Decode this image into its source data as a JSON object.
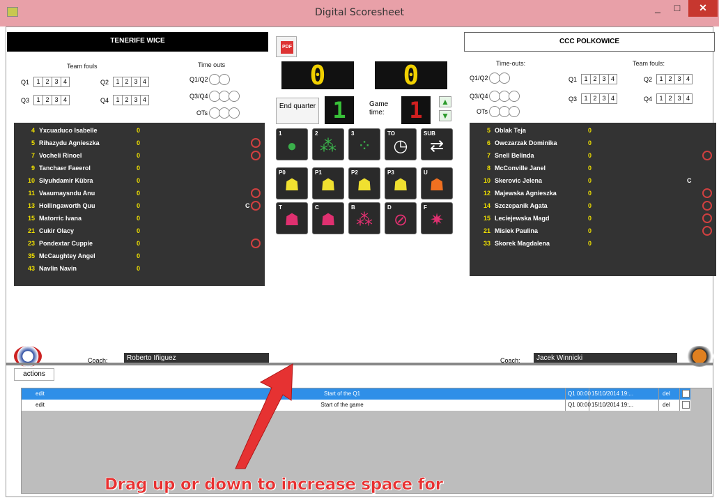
{
  "window": {
    "title": "Digital Scoresheet",
    "min": "_",
    "max": "□",
    "close": "✕"
  },
  "home": {
    "name": "TENERIFE WICE",
    "team_fouls_label": "Team fouls",
    "timeouts_label": "Time outs",
    "fouls": [
      {
        "q": "Q1",
        "cells": [
          "1",
          "2",
          "3",
          "4"
        ]
      },
      {
        "q": "Q2",
        "cells": [
          "1",
          "2",
          "3",
          "4"
        ]
      },
      {
        "q": "Q3",
        "cells": [
          "1",
          "2",
          "3",
          "4"
        ]
      },
      {
        "q": "Q4",
        "cells": [
          "1",
          "2",
          "3",
          "4"
        ]
      }
    ],
    "timeouts": [
      "Q1/Q2",
      "Q3/Q4",
      "OTs"
    ],
    "players": [
      {
        "num": "4",
        "name": "Yxcuaduco Isabelle",
        "pts": "0",
        "cap": "",
        "fouls": 0
      },
      {
        "num": "5",
        "name": "Rihazydu Agnieszka",
        "pts": "0",
        "cap": "",
        "fouls": 1
      },
      {
        "num": "7",
        "name": "Vocheli Rinoel",
        "pts": "0",
        "cap": "",
        "fouls": 1
      },
      {
        "num": "9",
        "name": "Tanchaer Faeerol",
        "pts": "0",
        "cap": "",
        "fouls": 0
      },
      {
        "num": "10",
        "name": "Siyuhdamir Kübra",
        "pts": "0",
        "cap": "",
        "fouls": 0
      },
      {
        "num": "11",
        "name": "Vaaumaysndu Anu",
        "pts": "0",
        "cap": "",
        "fouls": 1
      },
      {
        "num": "13",
        "name": "Hollingaworth Quu",
        "pts": "0",
        "cap": "C",
        "fouls": 1
      },
      {
        "num": "15",
        "name": "Matorric Ivana",
        "pts": "0",
        "cap": "",
        "fouls": 0
      },
      {
        "num": "21",
        "name": "Cukir Olacy",
        "pts": "0",
        "cap": "",
        "fouls": 0
      },
      {
        "num": "23",
        "name": "Pondextar Cuppie",
        "pts": "0",
        "cap": "",
        "fouls": 1
      },
      {
        "num": "35",
        "name": "McCaughtey Angel",
        "pts": "0",
        "cap": "",
        "fouls": 0
      },
      {
        "num": "43",
        "name": "Navlin Navin",
        "pts": "0",
        "cap": "",
        "fouls": 0
      }
    ],
    "coach_label": "Coach:",
    "coach": "Roberto Iñiguez"
  },
  "away": {
    "name": "CCC POLKOWICE",
    "team_fouls_label": "Team fouls:",
    "timeouts_label": "Time-outs:",
    "fouls": [
      {
        "q": "Q1",
        "cells": [
          "1",
          "2",
          "3",
          "4"
        ]
      },
      {
        "q": "Q2",
        "cells": [
          "1",
          "2",
          "3",
          "4"
        ]
      },
      {
        "q": "Q3",
        "cells": [
          "1",
          "2",
          "3",
          "4"
        ]
      },
      {
        "q": "Q4",
        "cells": [
          "1",
          "2",
          "3",
          "4"
        ]
      }
    ],
    "timeouts": [
      "Q1/Q2",
      "Q3/Q4",
      "OTs"
    ],
    "players": [
      {
        "num": "5",
        "name": "Oblak Teja",
        "pts": "0",
        "cap": "",
        "fouls": 0
      },
      {
        "num": "6",
        "name": "Owczarzak Dominika",
        "pts": "0",
        "cap": "",
        "fouls": 0
      },
      {
        "num": "7",
        "name": "Snell Belinda",
        "pts": "0",
        "cap": "",
        "fouls": 1
      },
      {
        "num": "8",
        "name": "McConville Janel",
        "pts": "0",
        "cap": "",
        "fouls": 0
      },
      {
        "num": "10",
        "name": "Skerovic Jelena",
        "pts": "0",
        "cap": "C",
        "fouls": 0
      },
      {
        "num": "12",
        "name": "Majewska Agnieszka",
        "pts": "0",
        "cap": "",
        "fouls": 1
      },
      {
        "num": "14",
        "name": "Szczepanik Agata",
        "pts": "0",
        "cap": "",
        "fouls": 1
      },
      {
        "num": "15",
        "name": "Leciejewska Magd",
        "pts": "0",
        "cap": "",
        "fouls": 1
      },
      {
        "num": "21",
        "name": "Misiek Paulina",
        "pts": "0",
        "cap": "",
        "fouls": 1
      },
      {
        "num": "33",
        "name": "Skorek Magdalena",
        "pts": "0",
        "cap": "",
        "fouls": 0
      }
    ],
    "coach_label": "Coach:",
    "coach": "Jacek Winnicki"
  },
  "center": {
    "pdf_label": "PDF",
    "score_home": "0",
    "score_away": "0",
    "period_label": "End quarter",
    "period_value": "1",
    "game_time_label": "Game time:",
    "game_time_value": "1",
    "up_arrow": "▲",
    "down_arrow": "▼",
    "action_row1": [
      {
        "tag": "1",
        "glyph": "●",
        "icon": "one-point-ball-icon",
        "color": "#3ab04a"
      },
      {
        "tag": "2",
        "glyph": "⁂",
        "icon": "two-point-balls-icon",
        "color": "#3ab04a"
      },
      {
        "tag": "3",
        "glyph": "⁘",
        "icon": "three-point-balls-icon",
        "color": "#3ab04a"
      },
      {
        "tag": "TO",
        "glyph": "◷",
        "icon": "timeout-clock-icon",
        "color": "#ffffff"
      },
      {
        "tag": "SUB",
        "glyph": "⇄",
        "icon": "substitution-arrows-icon",
        "color": "#ffffff"
      }
    ],
    "action_row2": [
      {
        "tag": "P0",
        "glyph": "☗",
        "icon": "foul-p0-player-icon",
        "color": "#f0e030"
      },
      {
        "tag": "P1",
        "glyph": "☗",
        "icon": "foul-p1-player-icon",
        "color": "#f0e030"
      },
      {
        "tag": "P2",
        "glyph": "☗",
        "icon": "foul-p2-player-icon",
        "color": "#f0e030"
      },
      {
        "tag": "P3",
        "glyph": "☗",
        "icon": "foul-p3-player-icon",
        "color": "#f0e030"
      },
      {
        "tag": "U",
        "glyph": "☗",
        "icon": "unsportsmanlike-foul-icon",
        "color": "#f07020"
      }
    ],
    "action_row3": [
      {
        "tag": "T",
        "glyph": "☗",
        "icon": "technical-foul-icon",
        "color": "#e03070"
      },
      {
        "tag": "C",
        "glyph": "☗",
        "icon": "coach-foul-icon",
        "color": "#e03070"
      },
      {
        "tag": "B",
        "glyph": "⁂",
        "icon": "bench-foul-icon",
        "color": "#e03070"
      },
      {
        "tag": "D",
        "glyph": "⊘",
        "icon": "disqualifying-foul-icon",
        "color": "#e03070"
      },
      {
        "tag": "F",
        "glyph": "✷",
        "icon": "fighting-foul-icon",
        "color": "#e03070"
      }
    ]
  },
  "actions": {
    "tab_label": "actions",
    "rows": [
      {
        "edit": "edit",
        "desc": "Start of the Q1",
        "time": "Q1 00:00",
        "date": "15/10/2014 19:...",
        "del": "del",
        "selected": true
      },
      {
        "edit": "edit",
        "desc": "Start of the game",
        "time": "Q1 00:00",
        "date": "15/10/2014 19:...",
        "del": "del",
        "selected": false
      }
    ]
  },
  "annotation": {
    "text": "Drag up or down to increase space for",
    "color": "#e83030"
  }
}
